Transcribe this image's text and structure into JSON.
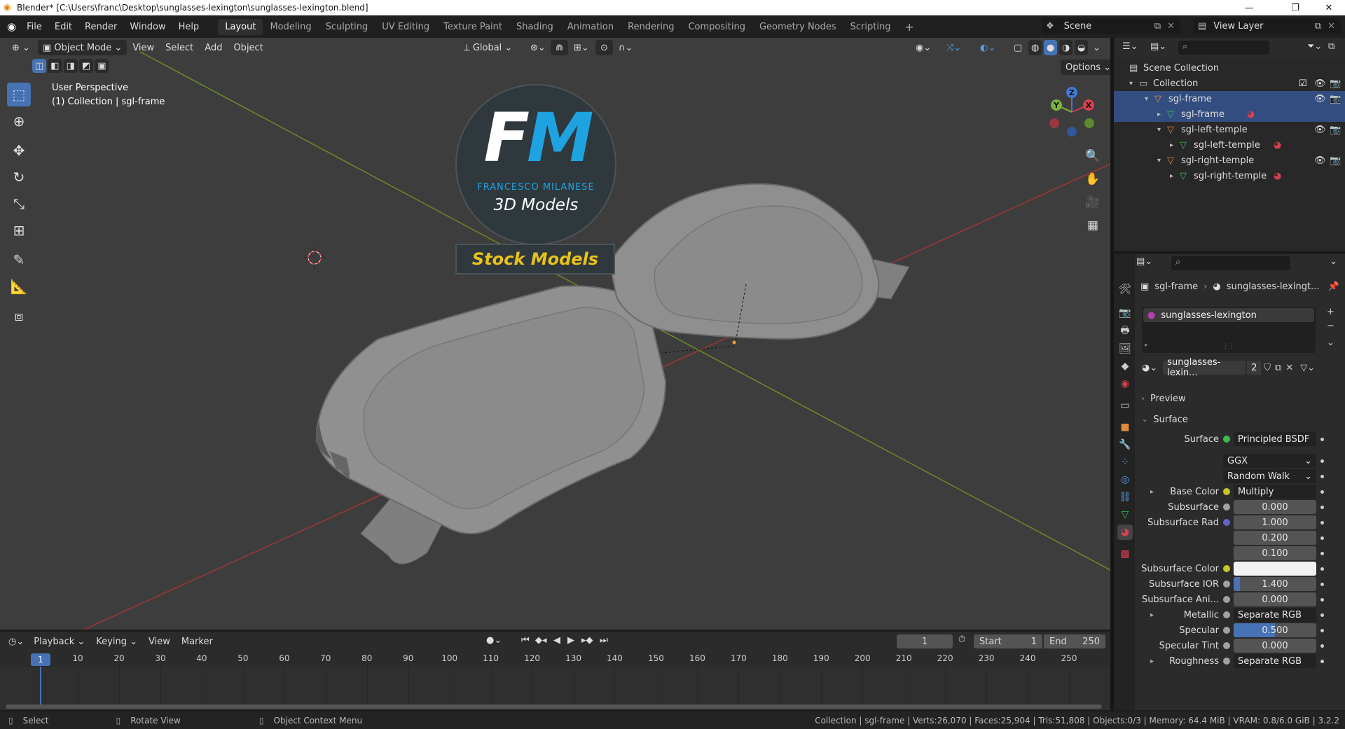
{
  "window": {
    "title": "Blender* [C:\\Users\\franc\\Desktop\\sunglasses-lexington\\sunglasses-lexington.blend]",
    "minimize": "—",
    "maximize": "❐",
    "close": "✕"
  },
  "menus": [
    "File",
    "Edit",
    "Render",
    "Window",
    "Help"
  ],
  "workspaces": [
    "Layout",
    "Modeling",
    "Sculpting",
    "UV Editing",
    "Texture Paint",
    "Shading",
    "Animation",
    "Rendering",
    "Compositing",
    "Geometry Nodes",
    "Scripting"
  ],
  "active_workspace": "Layout",
  "add_workspace": "+",
  "scene": {
    "name": "Scene"
  },
  "view_layer": {
    "name": "View Layer"
  },
  "viewport": {
    "mode": "Object Mode",
    "menus": [
      "View",
      "Select",
      "Add",
      "Object"
    ],
    "transform_orientation": "Global",
    "options": "Options",
    "overlay_title": "User Perspective",
    "overlay_subtitle": "(1) Collection | sgl-frame",
    "gizmo_axes": {
      "x": "X",
      "y": "Y",
      "z": "Z"
    }
  },
  "logo": {
    "letters": "FM",
    "name": "FRANCESCO MILANESE",
    "tagline": "3D Models",
    "banner": "Stock Models",
    "colors": {
      "f": "#ffffff",
      "m": "#1fa3e0",
      "banner_text": "#e8c21c"
    }
  },
  "outliner": {
    "search_placeholder": "",
    "items": [
      {
        "label": "Scene Collection",
        "depth": 0,
        "icon": "scene-collection-icon"
      },
      {
        "label": "Collection",
        "depth": 1,
        "icon": "collection-icon",
        "checked": true
      },
      {
        "label": "sgl-frame",
        "depth": 2,
        "icon": "mesh-object-icon"
      },
      {
        "label": "sgl-frame",
        "depth": 3,
        "icon": "mesh-data-icon"
      },
      {
        "label": "sgl-left-temple",
        "depth": 3,
        "icon": "mesh-object-icon"
      },
      {
        "label": "sgl-left-temple",
        "depth": 4,
        "icon": "mesh-data-icon"
      },
      {
        "label": "sgl-right-temple",
        "depth": 3,
        "icon": "mesh-object-icon"
      },
      {
        "label": "sgl-right-temple",
        "depth": 4,
        "icon": "mesh-data-icon"
      }
    ]
  },
  "properties": {
    "search_placeholder": "",
    "breadcrumb": {
      "object": "sgl-frame",
      "material": "sunglasses-lexingt..."
    },
    "material_slot": "sunglasses-lexington",
    "material_name": "sunglasses-lexin...",
    "material_users": "2",
    "panels": {
      "preview": "Preview",
      "surface": "Surface"
    },
    "rows": [
      {
        "label": "Surface",
        "kind": "link",
        "value": "Principled BSDF",
        "dot": "#3fb950"
      },
      {
        "label": "",
        "kind": "dropdown",
        "value": "GGX"
      },
      {
        "label": "",
        "kind": "dropdown",
        "value": "Random Walk"
      },
      {
        "label": "Base Color",
        "kind": "link",
        "value": "Multiply",
        "dot": "#c7c729",
        "expand": true
      },
      {
        "label": "Subsurface",
        "kind": "number",
        "value": "0.000",
        "dot": "#a1a1a1"
      },
      {
        "label": "Subsurface Rad",
        "kind": "number",
        "value": "1.000",
        "dot": "#6363c7"
      },
      {
        "label": "",
        "kind": "number",
        "value": "0.200"
      },
      {
        "label": "",
        "kind": "number",
        "value": "0.100"
      },
      {
        "label": "Subsurface Color",
        "kind": "color",
        "value": "",
        "dot": "#c7c729"
      },
      {
        "label": "Subsurface IOR",
        "kind": "slider",
        "value": "1.400",
        "fill": 0.08,
        "dot": "#a1a1a1"
      },
      {
        "label": "Subsurface Ani...",
        "kind": "number",
        "value": "0.000",
        "dot": "#a1a1a1"
      },
      {
        "label": "Metallic",
        "kind": "link",
        "value": "Separate RGB",
        "dot": "#a1a1a1",
        "expand": true
      },
      {
        "label": "Specular",
        "kind": "slider",
        "value": "0.500",
        "fill": 0.5,
        "dot": "#a1a1a1"
      },
      {
        "label": "Specular Tint",
        "kind": "number",
        "value": "0.000",
        "dot": "#a1a1a1"
      },
      {
        "label": "Roughness",
        "kind": "link",
        "value": "Separate RGB",
        "dot": "#a1a1a1",
        "expand": true
      }
    ]
  },
  "timeline": {
    "menus": [
      "Playback",
      "Keying",
      "View",
      "Marker"
    ],
    "current_frame": "1",
    "start_label": "Start",
    "start": "1",
    "end_label": "End",
    "end": "250",
    "ticks": [
      "1",
      "10",
      "20",
      "30",
      "40",
      "50",
      "60",
      "70",
      "80",
      "90",
      "100",
      "110",
      "120",
      "130",
      "140",
      "150",
      "160",
      "170",
      "180",
      "190",
      "200",
      "210",
      "220",
      "230",
      "240",
      "250"
    ]
  },
  "statusbar": {
    "left": [
      {
        "label": "Select",
        "icon": "mouse-left-icon"
      },
      {
        "label": "Rotate View",
        "icon": "mouse-middle-icon"
      },
      {
        "label": "Object Context Menu",
        "icon": "mouse-right-icon"
      }
    ],
    "stats": "Collection | sgl-frame | Verts:26,070 | Faces:25,904 | Tris:51,808 | Objects:0/3 | Memory: 64.4 MiB | VRAM: 0.8/6.0 GiB | 3.2.2"
  }
}
